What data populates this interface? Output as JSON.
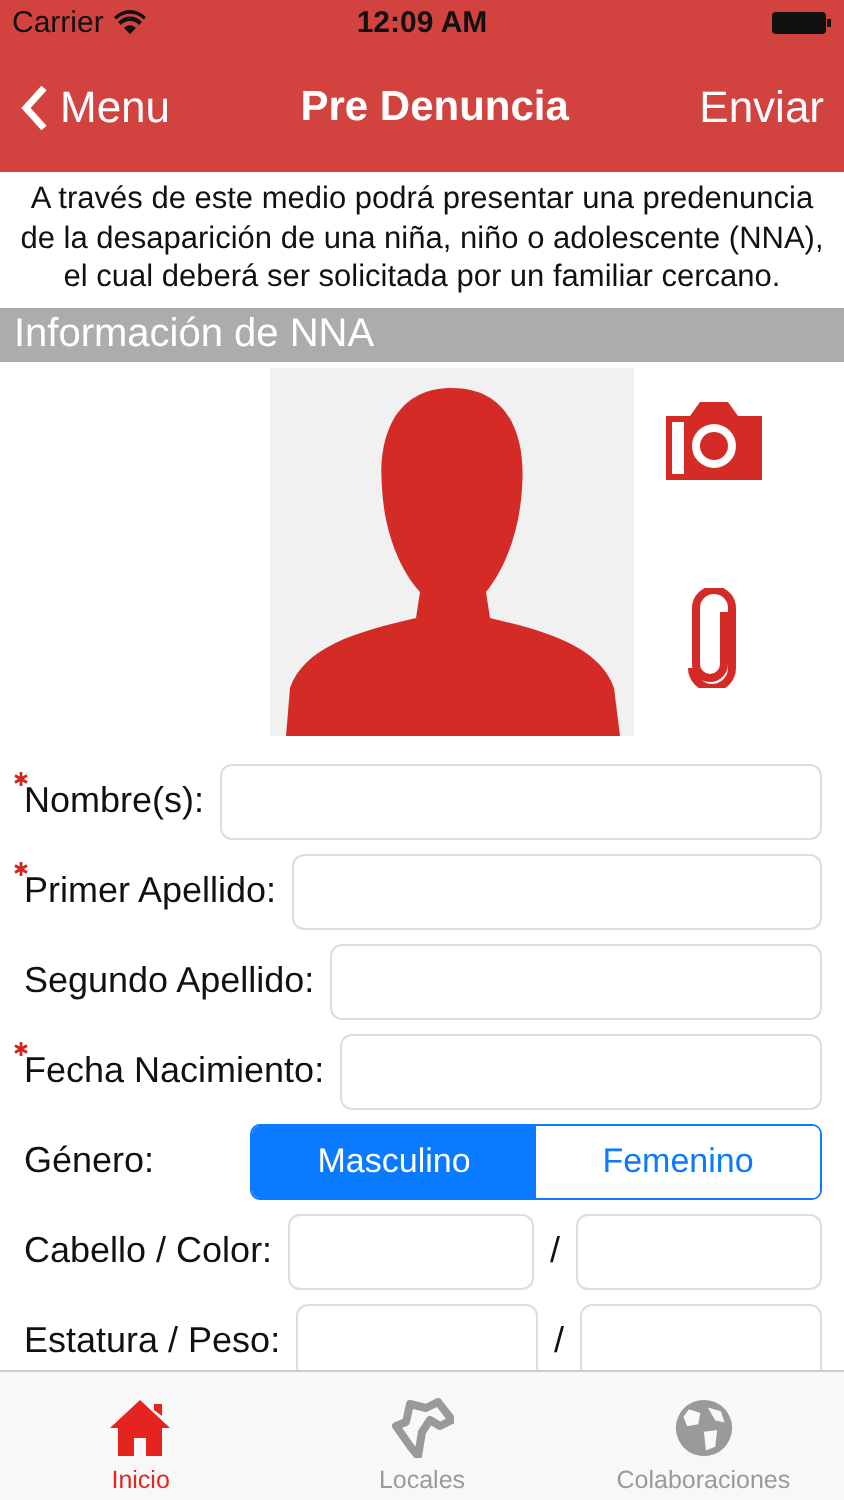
{
  "status_bar": {
    "carrier": "Carrier",
    "time": "12:09 AM"
  },
  "nav": {
    "back": "Menu",
    "title": "Pre Denuncia",
    "action": "Enviar"
  },
  "intro": "A través de este medio podrá presentar una predenuncia de la desaparición de una niña, niño o adolescente (NNA), el cual deberá ser solicitada por un familiar cercano.",
  "section": {
    "title": "Información de NNA"
  },
  "fields": [
    {
      "kind": "text",
      "label": "Nombre(s):",
      "required": true
    },
    {
      "kind": "text",
      "label": "Primer Apellido:",
      "required": true
    },
    {
      "kind": "text",
      "label": "Segundo Apellido:",
      "required": false
    },
    {
      "kind": "text",
      "label": "Fecha Nacimiento:",
      "required": true
    },
    {
      "kind": "segment",
      "label": "Género:",
      "options": [
        {
          "label": "Masculino",
          "selected": true
        },
        {
          "label": "Femenino",
          "selected": false
        }
      ]
    },
    {
      "kind": "pair",
      "label": "Cabello / Color:",
      "separator": "/"
    },
    {
      "kind": "pair",
      "label": "Estatura / Peso:",
      "separator": "/"
    }
  ],
  "tabs": [
    {
      "label": "Inicio",
      "selected": true,
      "kind": "home"
    },
    {
      "label": "Locales",
      "selected": false,
      "kind": "map"
    },
    {
      "label": "Colaboraciones",
      "selected": false,
      "kind": "globe"
    }
  ]
}
